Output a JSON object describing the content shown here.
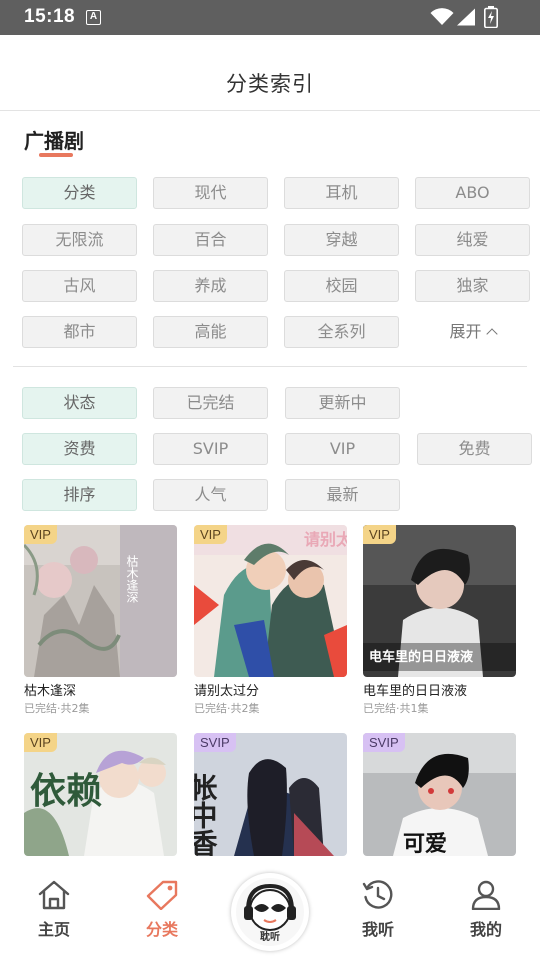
{
  "status_bar": {
    "time": "15:18",
    "notification_letter": "A"
  },
  "header": {
    "title": "分类索引"
  },
  "section": {
    "title": "广播剧"
  },
  "category_filter": {
    "items": [
      "分类",
      "现代",
      "耳机",
      "ABO",
      "无限流",
      "百合",
      "穿越",
      "纯爱",
      "古风",
      "养成",
      "校园",
      "独家",
      "都市",
      "高能",
      "全系列"
    ],
    "expand_label": "展开"
  },
  "status_filter": [
    "状态",
    "已完结",
    "更新中"
  ],
  "price_filter": [
    "资费",
    "SVIP",
    "VIP",
    "免费"
  ],
  "sort_filter": [
    "排序",
    "人气",
    "最新"
  ],
  "dramas": [
    {
      "badge": "VIP",
      "title": "枯木逢深",
      "meta": "已完结·共2集",
      "cover_text": "枯木逢深"
    },
    {
      "badge": "VIP",
      "title": "请别太过分",
      "meta": "已完结·共2集",
      "cover_text": "请别太过分"
    },
    {
      "badge": "VIP",
      "title": "电车里的日日液液",
      "meta": "已完结·共1集",
      "cover_text": "电车里的日日液液"
    },
    {
      "badge": "VIP",
      "title": "",
      "meta": "",
      "cover_text": "依赖"
    },
    {
      "badge": "SVIP",
      "title": "",
      "meta": "",
      "cover_text": "帐中香"
    },
    {
      "badge": "SVIP",
      "title": "",
      "meta": "",
      "cover_text": "可爱"
    }
  ],
  "bottom_nav": {
    "home": "主页",
    "category": "分类",
    "center": "耽听",
    "listen": "我听",
    "mine": "我的"
  },
  "colors": {
    "accent": "#e8785e",
    "active_chip": "#e5f4ef",
    "vip_badge": "#f4d488",
    "svip_badge": "#d7c1f3"
  }
}
